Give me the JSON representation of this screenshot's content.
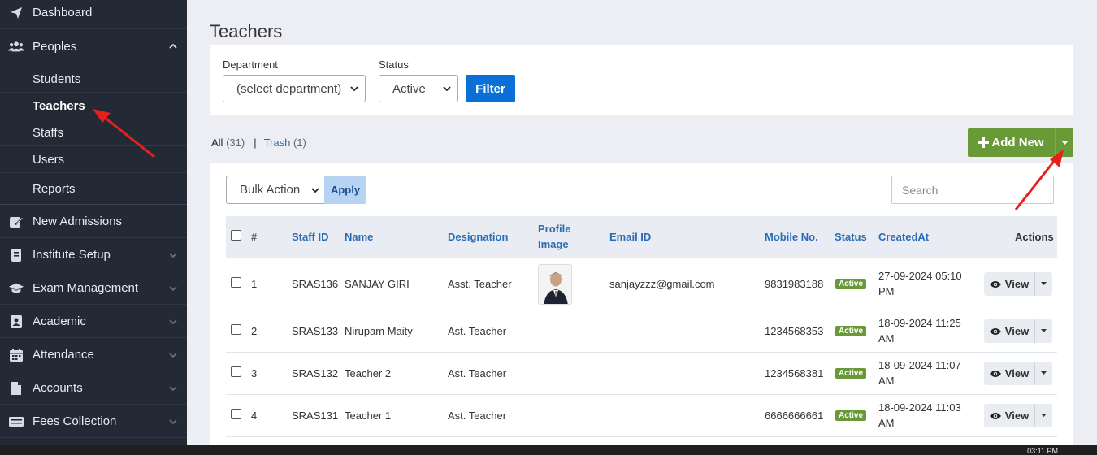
{
  "sidebar": {
    "items": [
      {
        "label": "Dashboard",
        "icon": "paper-plane-icon"
      },
      {
        "label": "Peoples",
        "icon": "users-icon",
        "expanded": true
      },
      {
        "label": "New Admissions",
        "icon": "edit-icon"
      },
      {
        "label": "Institute Setup",
        "icon": "book-icon"
      },
      {
        "label": "Exam Management",
        "icon": "graduation-cap-icon"
      },
      {
        "label": "Academic",
        "icon": "id-card-icon"
      },
      {
        "label": "Attendance",
        "icon": "calendar-icon"
      },
      {
        "label": "Accounts",
        "icon": "file-icon"
      },
      {
        "label": "Fees Collection",
        "icon": "money-icon"
      }
    ],
    "sub_items": [
      {
        "label": "Students"
      },
      {
        "label": "Teachers",
        "active": true
      },
      {
        "label": "Staffs"
      },
      {
        "label": "Users"
      },
      {
        "label": "Reports"
      }
    ]
  },
  "page": {
    "title": "Teachers"
  },
  "filters": {
    "department_label": "Department",
    "department_value": "(select department)",
    "status_label": "Status",
    "status_value": "Active",
    "filter_button": "Filter"
  },
  "tabs": {
    "all_label": "All",
    "all_count": "(31)",
    "separator": "|",
    "trash_label": "Trash",
    "trash_count": "(1)"
  },
  "add_new": {
    "label": "Add New"
  },
  "toolbar": {
    "bulk_action": "Bulk Action",
    "apply": "Apply",
    "search_placeholder": "Search"
  },
  "table": {
    "headers": {
      "num": "#",
      "staff_id": "Staff ID",
      "name": "Name",
      "designation": "Designation",
      "profile_image_1": "Profile",
      "profile_image_2": "Image",
      "email": "Email ID",
      "mobile": "Mobile No.",
      "status": "Status",
      "created_at": "CreatedAt",
      "actions": "Actions"
    },
    "view_label": "View",
    "rows": [
      {
        "num": "1",
        "staff_id": "SRAS136",
        "name": "SANJAY GIRI",
        "designation": "Asst. Teacher",
        "email": "sanjayzzz@gmail.com",
        "mobile": "9831983188",
        "status": "Active",
        "created_1": "27-09-2024 05:10",
        "created_2": "PM"
      },
      {
        "num": "2",
        "staff_id": "SRAS133",
        "name": "Nirupam Maity",
        "designation": "Ast. Teacher",
        "email": "",
        "mobile": "1234568353",
        "status": "Active",
        "created_1": "18-09-2024 11:25",
        "created_2": "AM"
      },
      {
        "num": "3",
        "staff_id": "SRAS132",
        "name": "Teacher 2",
        "designation": "Ast. Teacher",
        "email": "",
        "mobile": "1234568381",
        "status": "Active",
        "created_1": "18-09-2024 11:07",
        "created_2": "AM"
      },
      {
        "num": "4",
        "staff_id": "SRAS131",
        "name": "Teacher 1",
        "designation": "Ast. Teacher",
        "email": "",
        "mobile": "6666666661",
        "status": "Active",
        "created_1": "18-09-2024 11:03",
        "created_2": "AM"
      }
    ]
  },
  "taskbar": {
    "clock": "03:11 PM"
  },
  "colors": {
    "sidebar": "#232a35",
    "primary": "#0b6fd8",
    "success": "#6a9a38",
    "annotation": "#e8201d"
  }
}
